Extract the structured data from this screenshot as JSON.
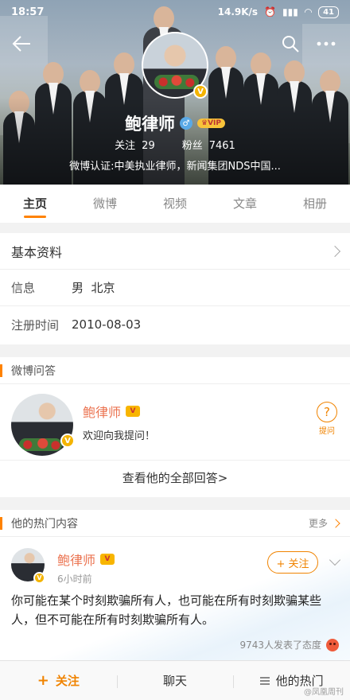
{
  "status_bar": {
    "time": "18:57",
    "speed": "14.9K/s",
    "battery": "41"
  },
  "profile": {
    "name": "鲍律师",
    "vip_label": "VIP",
    "follow_label": "关注",
    "follow_count": "29",
    "fans_label": "粉丝",
    "fans_count": "7461",
    "verification": "微博认证:中美执业律师，新闻集团NDS中国..."
  },
  "tabs": [
    {
      "label": "主页",
      "active": true
    },
    {
      "label": "微博",
      "active": false
    },
    {
      "label": "视频",
      "active": false
    },
    {
      "label": "文章",
      "active": false
    },
    {
      "label": "相册",
      "active": false
    }
  ],
  "basic_info": {
    "title": "基本资料",
    "rows": [
      {
        "key": "信息",
        "value": "男  北京"
      },
      {
        "key": "注册时间",
        "value": "2010-08-03"
      }
    ]
  },
  "qa": {
    "title": "微博问答",
    "name": "鲍律师",
    "desc": "欢迎向我提问！",
    "ask_label": "提问",
    "view_all": "查看他的全部回答>"
  },
  "hot": {
    "title": "他的热门内容",
    "more": "更多",
    "post": {
      "name": "鲍律师",
      "time": "6小时前",
      "follow_btn": "+ 关注",
      "text": "你可能在某个时刻欺骗所有人，也可能在所有时刻欺骗某些人，但不可能在所有时刻欺骗所有人。",
      "reactions": "9743人发表了态度"
    }
  },
  "bottom_bar": {
    "follow": "关注",
    "chat": "聊天",
    "hot": "他的热门"
  },
  "watermark": "@凤凰周刊",
  "colors": {
    "accent": "#ff8200",
    "name": "#eb7350"
  }
}
